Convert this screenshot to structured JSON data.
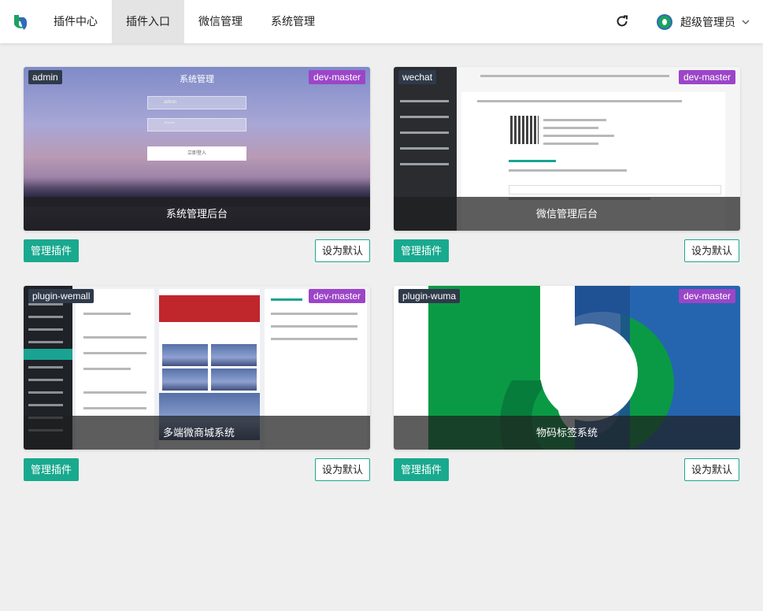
{
  "nav": {
    "items": [
      {
        "label": "插件中心",
        "active": false
      },
      {
        "label": "插件入口",
        "active": true
      },
      {
        "label": "微信管理",
        "active": false
      },
      {
        "label": "系统管理",
        "active": false
      }
    ]
  },
  "user": {
    "name": "超级管理员"
  },
  "actions": {
    "manage_label": "管理插件",
    "default_label": "设为默认"
  },
  "plugins": [
    {
      "code": "admin",
      "branch": "dev-master",
      "name": "系统管理后台",
      "preview": {
        "title": "系统管理",
        "username": "admin",
        "password": "******",
        "login": "立即登入"
      }
    },
    {
      "code": "wechat",
      "branch": "dev-master",
      "name": "微信管理后台"
    },
    {
      "code": "plugin-wemall",
      "branch": "dev-master",
      "name": "多端微商城系统"
    },
    {
      "code": "plugin-wuma",
      "branch": "dev-master",
      "name": "物码标签系统"
    }
  ],
  "colors": {
    "accent": "#19a98f",
    "branch_tag": "#9c45c8",
    "code_tag": "#2f3a4a",
    "active_nav": "#e4e4e4"
  }
}
